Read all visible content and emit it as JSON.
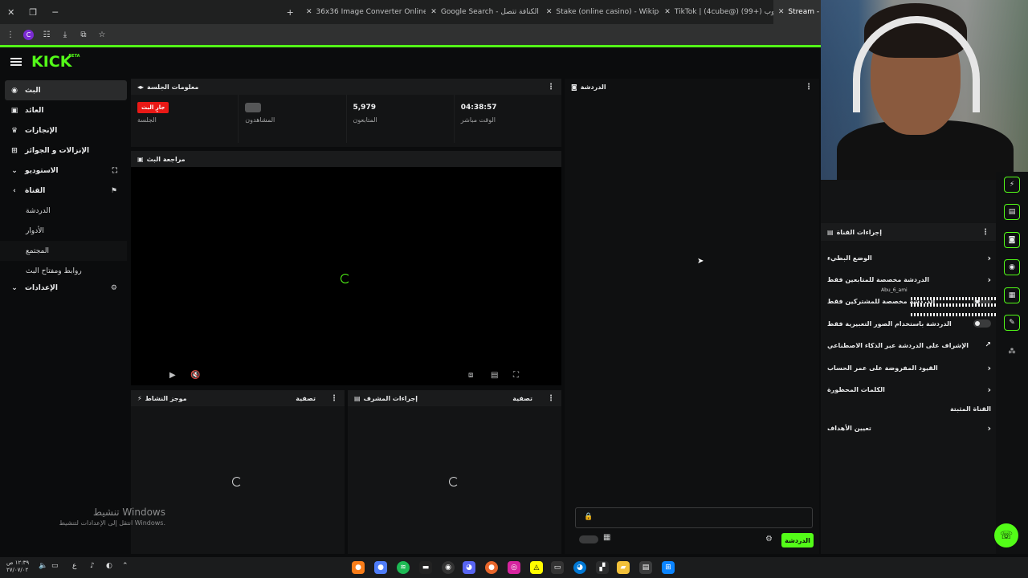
{
  "browser": {
    "tabs": [
      {
        "title": "36x36 Image Converter Online",
        "color": "#4a90e2"
      },
      {
        "title": "Google Search - الكنافة تتصل",
        "color": "#a26bd6"
      },
      {
        "title": "Stake (online casino) - Wikipedia",
        "color": "#ffffff"
      },
      {
        "title": "TikTok | (4cube@) كيوب (+99)",
        "color": "#e9eaeb"
      },
      {
        "title": "Stream - Kick",
        "color": "#53fc18"
      }
    ],
    "new_tab_label": "+",
    "profile_initial": "C"
  },
  "header": {
    "logo": "KICK",
    "logo_badge": "BETA"
  },
  "sidebar": {
    "items": [
      {
        "label": "البث",
        "icon": "broadcast-icon"
      },
      {
        "label": "العائد",
        "icon": "wallet-icon"
      },
      {
        "label": "الإنجازات",
        "icon": "trophy-icon"
      },
      {
        "label": "الإنزالات و الجوائز",
        "icon": "gift-icon"
      },
      {
        "label": "الاستوديو",
        "icon": "studio-icon"
      },
      {
        "label": "القناة",
        "icon": "channel-icon"
      }
    ],
    "subitems": [
      "الدردشة",
      "الأدوار",
      "المجتمع",
      "روابط ومفتاح البث"
    ],
    "settings_label": "الإعدادات"
  },
  "session": {
    "title": "معلومات الجلسة",
    "live_badge": "جارٍ البث",
    "stats": [
      {
        "label": "الجلسة",
        "value": ""
      },
      {
        "label": "المشاهدون",
        "value": ""
      },
      {
        "label": "المتابعون",
        "value": "5,979"
      },
      {
        "label": "الوقت مباشر",
        "value": "04:38:57"
      }
    ]
  },
  "preview": {
    "title": "مراجعة البث"
  },
  "activity": {
    "title": "موجز النشاط",
    "filter": "تصفية"
  },
  "modactions": {
    "title": "إجراءات المشرف",
    "filter": "تصفية"
  },
  "chat": {
    "title": "الدردشة",
    "send_label": "الدردشة"
  },
  "channel_actions": {
    "title": "إجراءات القناة",
    "rows": [
      {
        "label": "الوضع البطيء",
        "control": "chevron"
      },
      {
        "label": "الدردشة مخصصة للمتابعين فقط",
        "control": "chevron"
      },
      {
        "label": "الدردشة مخصصة للمشتركين فقط",
        "control": "toggle"
      },
      {
        "label": "الدردشة باستخدام الصور التعبيرية فقط",
        "control": "toggle"
      },
      {
        "label": "الإشراف على الدردشة عبر الذكاء الاصطناعي",
        "control": "external"
      },
      {
        "label": "القيود المفروضة على عمر الحساب",
        "control": "chevron"
      },
      {
        "label": "الكلمات المحظورة",
        "control": "chevron"
      },
      {
        "label": "القناة المثبتة",
        "control": "none"
      },
      {
        "label": "تعيين الأهداف",
        "control": "chevron"
      }
    ],
    "overlay_user": "Abu_6_ami"
  },
  "watermark": {
    "title": "تنشيط Windows",
    "subtitle": "انتقل إلى الإعدادات لتنشيط Windows."
  },
  "taskbar": {
    "time": "١٢:٣٩ ص",
    "date": "٢٧/٠٧/٠٢"
  },
  "colors": {
    "accent": "#53fc18",
    "live": "#e91916"
  }
}
